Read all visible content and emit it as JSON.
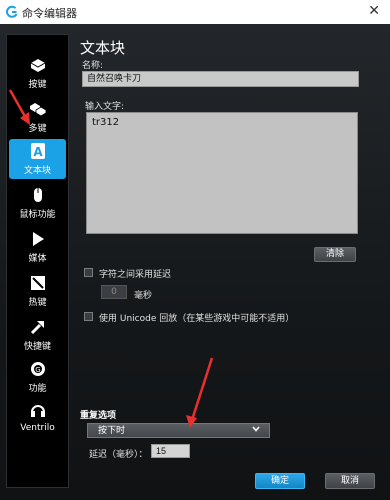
{
  "window": {
    "title": "命令编辑器",
    "close_symbol": "✕"
  },
  "sidebar": {
    "items": [
      {
        "label": "按键",
        "icon": "key-icon"
      },
      {
        "label": "多键",
        "icon": "multikey-icon"
      },
      {
        "label": "文本块",
        "icon": "text-block-icon",
        "active": true
      },
      {
        "label": "鼠标功能",
        "icon": "mouse-icon"
      },
      {
        "label": "媒体",
        "icon": "media-play-icon"
      },
      {
        "label": "热键",
        "icon": "hotkey-icon"
      },
      {
        "label": "快捷键",
        "icon": "shortcut-arrow-icon"
      },
      {
        "label": "功能",
        "icon": "function-gear-icon"
      },
      {
        "label": "Ventrilo",
        "icon": "ventrilo-headset-icon"
      }
    ]
  },
  "main": {
    "title": "文本块",
    "name_label": "名称:",
    "name_value": "自然召唤卡刀",
    "input_label": "输入文字:",
    "input_text": "tr312",
    "clear_button": "清除",
    "char_delay_checkbox": "字符之间采用延迟",
    "char_delay_value": "0",
    "char_delay_unit": "毫秒",
    "unicode_checkbox": "使用 Unicode 回放（在某些游戏中可能不适用）"
  },
  "repeat": {
    "title": "重复选项",
    "mode_selected": "按下时",
    "delay_label": "延迟（毫秒）：",
    "delay_value": "15"
  },
  "footer": {
    "ok_button": "确定",
    "cancel_button": "取消"
  },
  "colors": {
    "accent": "#1aa1e6",
    "annotation_arrow": "#e8302d"
  }
}
